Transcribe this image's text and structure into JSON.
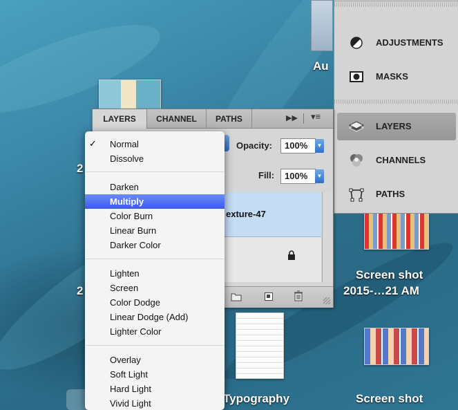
{
  "desktop": {
    "labels": {
      "au": "Au",
      "left_two_a": "2",
      "left_two_b": "2",
      "screenshot1_line1": "Screen shot",
      "screenshot1_line2": "2015-…21 AM",
      "typography": "Typography",
      "screenshot2": "Screen shot"
    }
  },
  "dock": {
    "items": [
      {
        "label": "ADJUSTMENTS",
        "icon": "adjustments-icon"
      },
      {
        "label": "MASKS",
        "icon": "masks-icon"
      },
      {
        "label": "LAYERS",
        "icon": "layers-icon",
        "active": true
      },
      {
        "label": "CHANNELS",
        "icon": "channels-icon"
      },
      {
        "label": "PATHS",
        "icon": "paths-icon"
      }
    ]
  },
  "layers_panel": {
    "tabs": [
      "LAYERS",
      "CHANNEL",
      "PATHS"
    ],
    "opacity_label": "Opacity:",
    "opacity_value": "100%",
    "fill_label": "Fill:",
    "fill_value": "100%",
    "layer_name": "exture-47"
  },
  "blend_menu": {
    "groups": [
      [
        "Normal",
        "Dissolve"
      ],
      [
        "Darken",
        "Multiply",
        "Color Burn",
        "Linear Burn",
        "Darker Color"
      ],
      [
        "Lighten",
        "Screen",
        "Color Dodge",
        "Linear Dodge (Add)",
        "Lighter Color"
      ],
      [
        "Overlay",
        "Soft Light",
        "Hard Light",
        "Vivid Light"
      ]
    ],
    "checked": "Normal",
    "highlighted": "Multiply",
    "checkmark": "✓"
  },
  "colors": {
    "highlight": "#3c5ae8",
    "layer_selected": "#c5dcf5",
    "desktop": "#2d6f8d"
  }
}
